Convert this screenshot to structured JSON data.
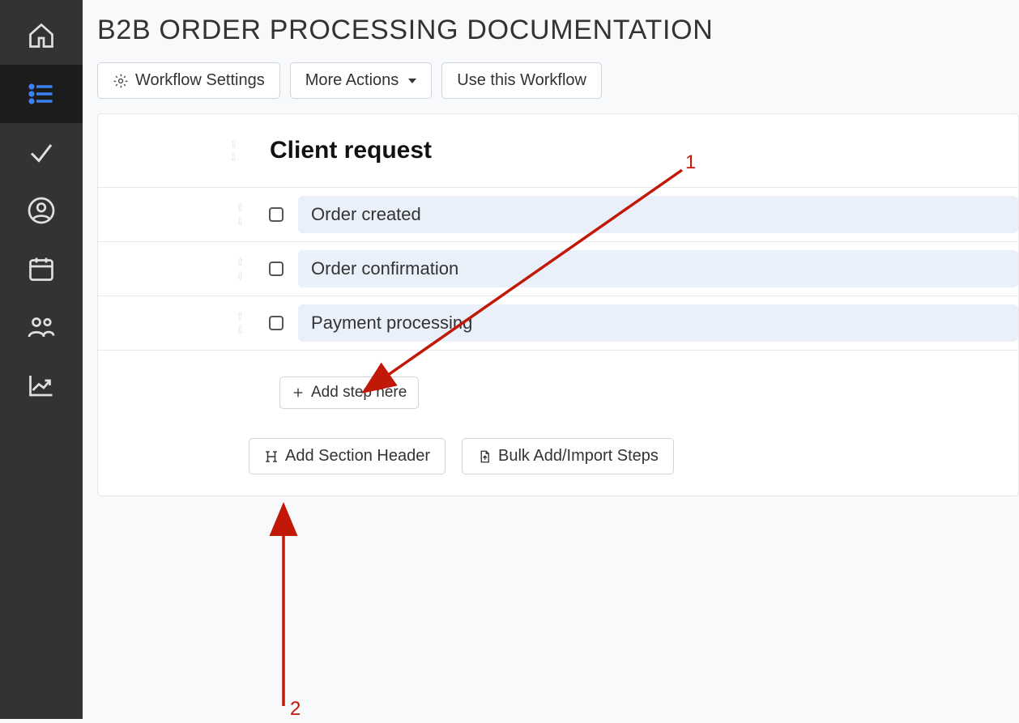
{
  "page": {
    "title": "B2B ORDER PROCESSING DOCUMENTATION"
  },
  "toolbar": {
    "workflow_settings": "Workflow Settings",
    "more_actions": "More Actions",
    "use_workflow": "Use this Workflow"
  },
  "section": {
    "title": "Client request"
  },
  "steps": [
    {
      "label": "Order created"
    },
    {
      "label": "Order confirmation"
    },
    {
      "label": "Payment processing"
    }
  ],
  "add_step": {
    "label": "Add step here"
  },
  "bottom": {
    "add_section_header": "Add Section Header",
    "bulk_import": "Bulk Add/Import Steps"
  },
  "sidebar": {
    "items": [
      {
        "id": "home",
        "icon": "home"
      },
      {
        "id": "list",
        "icon": "list",
        "active": true
      },
      {
        "id": "check",
        "icon": "check"
      },
      {
        "id": "user",
        "icon": "user"
      },
      {
        "id": "calendar",
        "icon": "calendar"
      },
      {
        "id": "team",
        "icon": "team"
      },
      {
        "id": "chart",
        "icon": "chart"
      }
    ]
  },
  "annotations": [
    {
      "id": "1",
      "label": "1"
    },
    {
      "id": "2",
      "label": "2"
    }
  ]
}
